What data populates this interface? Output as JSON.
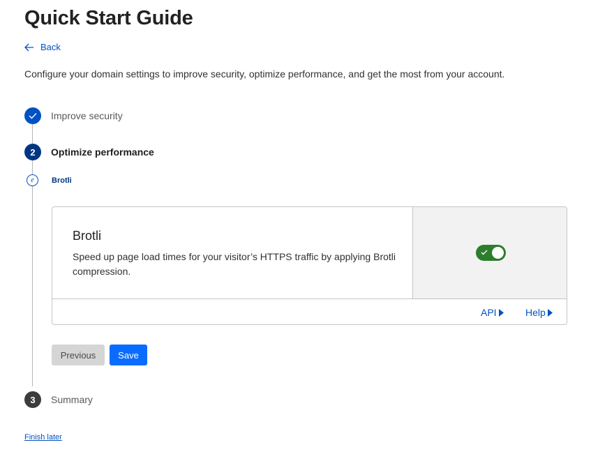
{
  "page": {
    "title": "Quick Start Guide",
    "back_label": "Back",
    "intro": "Configure your domain settings to improve security, optimize performance, and get the most from your account.",
    "finish_later": "Finish later"
  },
  "steps": [
    {
      "number": "1",
      "label": "Improve security",
      "state": "completed",
      "icon": "check-icon"
    },
    {
      "number": "2",
      "label": "Optimize performance",
      "state": "active"
    },
    {
      "number": "3",
      "label": "Summary",
      "state": "upcoming"
    }
  ],
  "substep": {
    "label": "Brotli",
    "icon_glyph": "e"
  },
  "card": {
    "title": "Brotli",
    "description": "Speed up page load times for your visitor’s HTTPS traffic by applying Brotli compression.",
    "toggle_on": true,
    "api_label": "API",
    "help_label": "Help"
  },
  "buttons": {
    "previous": "Previous",
    "save": "Save"
  },
  "colors": {
    "accent": "#0051c3",
    "primary_button": "#0a6cff",
    "toggle_on": "#2c7d2c"
  }
}
